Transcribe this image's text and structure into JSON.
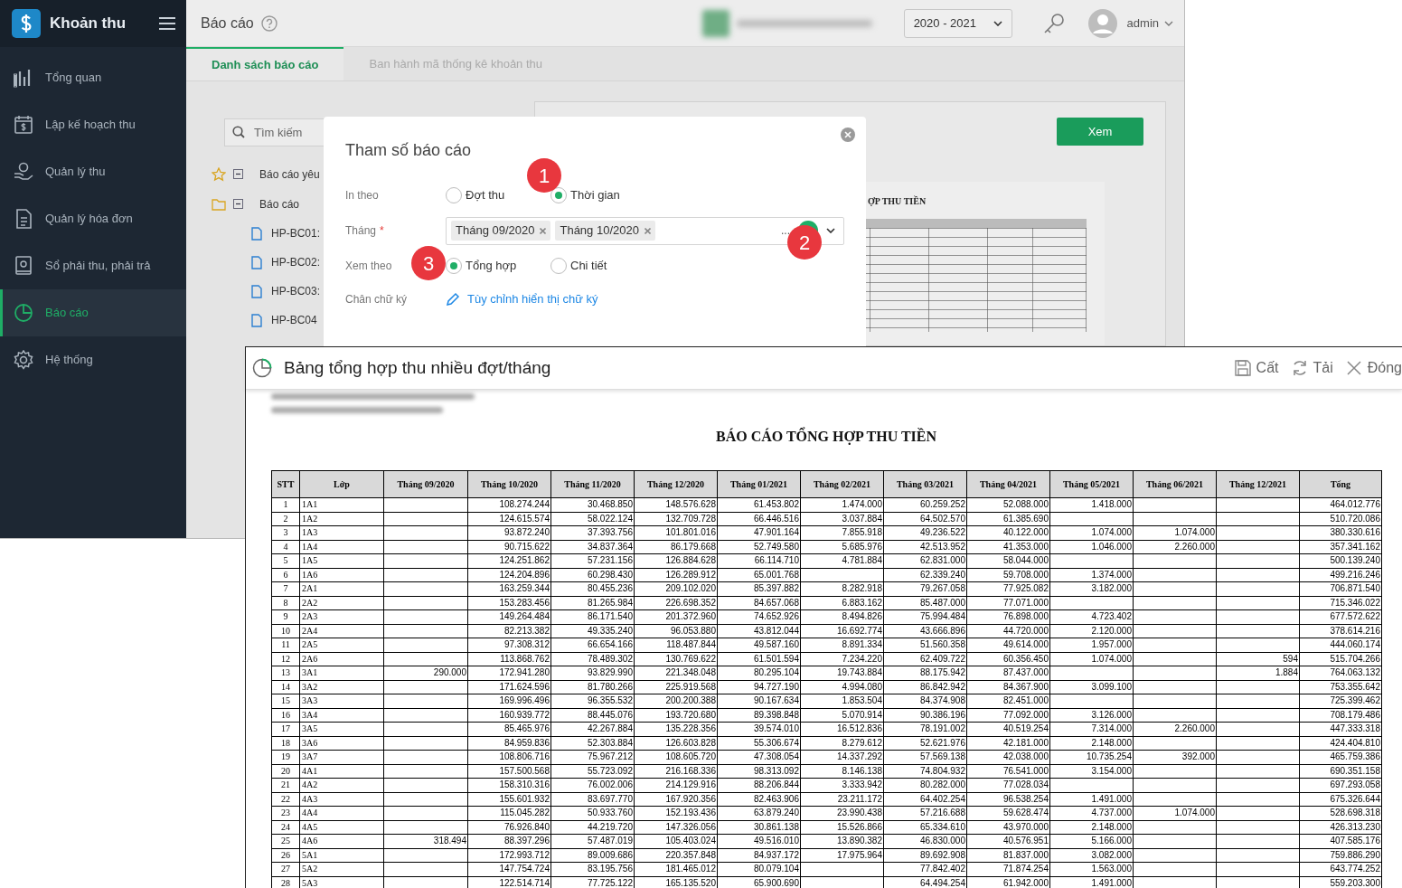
{
  "app": {
    "logo": "Khoản thu",
    "sidebar": [
      {
        "kind": "overview",
        "label": "Tổng quan",
        "selected": false
      },
      {
        "kind": "plan",
        "label": "Lập kế hoạch thu",
        "selected": false
      },
      {
        "kind": "collect",
        "label": "Quản lý thu",
        "selected": false
      },
      {
        "kind": "invoice",
        "label": "Quản lý hóa đơn",
        "selected": false
      },
      {
        "kind": "ledger",
        "label": "Sổ phải thu, phải trả",
        "selected": false
      },
      {
        "kind": "report",
        "label": "Báo cáo",
        "selected": true
      },
      {
        "kind": "settings",
        "label": "Hệ thống",
        "selected": false
      }
    ],
    "header": {
      "title": "Báo cáo",
      "year": "2020 - 2021",
      "user": "admin"
    },
    "tabs": [
      {
        "label": "Danh sách báo cáo",
        "selected": true
      },
      {
        "label": "Ban hành mã thống kê khoản thu",
        "selected": false
      }
    ],
    "search": {
      "placeholder": "Tìm kiếm"
    },
    "tree": [
      {
        "kind": "favorite",
        "label": "Báo cáo yêu",
        "expanded": true
      },
      {
        "kind": "folder",
        "label": "Báo cáo",
        "expanded": true,
        "children": [
          {
            "label": "HP-BC01:"
          },
          {
            "label": "HP-BC02:"
          },
          {
            "label": "HP-BC03:"
          },
          {
            "label": "HP-BC04"
          }
        ]
      }
    ],
    "view_button": "Xem",
    "preview_heading": "ỢP THU TIỀN"
  },
  "dialog": {
    "title": "Tham số báo cáo",
    "fields": [
      {
        "kind": "radio",
        "label": "In theo",
        "options": [
          {
            "label": "Đợt thu",
            "selected": false
          },
          {
            "label": "Thời gian",
            "selected": true
          }
        ]
      },
      {
        "kind": "tags",
        "label": "Tháng",
        "required_mark": "*",
        "tags": [
          "Tháng 09/2020",
          "Tháng 10/2020"
        ],
        "more": "..."
      },
      {
        "kind": "radio",
        "label": "Xem theo",
        "options": [
          {
            "label": "Tổng hợp",
            "selected": true
          },
          {
            "label": "Chi tiết",
            "selected": false
          }
        ]
      },
      {
        "kind": "link",
        "label": "Chân chữ ký",
        "link": "Tùy chỉnh hiển thị chữ ký"
      }
    ]
  },
  "callouts": [
    "1",
    "2",
    "3"
  ],
  "report": {
    "title": "Bảng tổng hợp thu nhiều đợt/tháng",
    "actions": [
      {
        "kind": "save",
        "label": "Cất"
      },
      {
        "kind": "reload",
        "label": "Tải"
      },
      {
        "kind": "close",
        "label": "Đóng"
      }
    ],
    "heading": "BÁO CÁO TỔNG HỢP THU TIỀN",
    "table": {
      "columns": [
        "STT",
        "Lớp",
        "Tháng 09/2020",
        "Tháng 10/2020",
        "Tháng 11/2020",
        "Tháng 12/2020",
        "Tháng 01/2021",
        "Tháng 02/2021",
        "Tháng 03/2021",
        "Tháng 04/2021",
        "Tháng 05/2021",
        "Tháng 06/2021",
        "Tháng 12/2021",
        "Tổng"
      ],
      "rows": [
        [
          "1",
          "1A1",
          null,
          "108.274.244",
          "30.468.850",
          "148.576.628",
          "61.453.802",
          "1.474.000",
          "60.259.252",
          "52.088.000",
          "1.418.000",
          null,
          null,
          "464.012.776"
        ],
        [
          "2",
          "1A2",
          null,
          "124.615.574",
          "58.022.124",
          "132.709.728",
          "66.446.516",
          "3.037.884",
          "64.502.570",
          "61.385.690",
          null,
          null,
          null,
          "510.720.086"
        ],
        [
          "3",
          "1A3",
          null,
          "93.872.240",
          "37.393.756",
          "101.801.016",
          "47.901.164",
          "7.855.918",
          "49.236.522",
          "40.122.000",
          "1.074.000",
          "1.074.000",
          null,
          "380.330.616"
        ],
        [
          "4",
          "1A4",
          null,
          "90.715.622",
          "34.837.364",
          "86.179.668",
          "52.749.580",
          "5.685.976",
          "42.513.952",
          "41.353.000",
          "1.046.000",
          "2.260.000",
          null,
          "357.341.162"
        ],
        [
          "5",
          "1A5",
          null,
          "124.251.862",
          "57.231.156",
          "126.884.628",
          "66.114.710",
          "4.781.884",
          "62.831.000",
          "58.044.000",
          null,
          null,
          null,
          "500.139.240"
        ],
        [
          "6",
          "1A6",
          null,
          "124.204.896",
          "60.298.430",
          "126.289.912",
          "65.001.768",
          null,
          "62.339.240",
          "59.708.000",
          "1.374.000",
          null,
          null,
          "499.216.246"
        ],
        [
          "7",
          "2A1",
          null,
          "163.259.344",
          "80.455.236",
          "209.102.020",
          "85.397.882",
          "8.282.918",
          "79.267.058",
          "77.925.082",
          "3.182.000",
          null,
          null,
          "706.871.540"
        ],
        [
          "8",
          "2A2",
          null,
          "153.283.456",
          "81.265.984",
          "226.698.352",
          "84.657.068",
          "6.883.162",
          "85.487.000",
          "77.071.000",
          null,
          null,
          null,
          "715.346.022"
        ],
        [
          "9",
          "2A3",
          null,
          "149.264.484",
          "86.171.540",
          "201.372.960",
          "74.652.926",
          "8.494.826",
          "75.994.484",
          "76.898.000",
          "4.723.402",
          null,
          null,
          "677.572.622"
        ],
        [
          "10",
          "2A4",
          null,
          "82.213.382",
          "49.335.240",
          "96.053.880",
          "43.812.044",
          "16.692.774",
          "43.666.896",
          "44.720.000",
          "2.120.000",
          null,
          null,
          "378.614.216"
        ],
        [
          "11",
          "2A5",
          null,
          "97.308.312",
          "66.654.166",
          "118.487.844",
          "49.587.160",
          "8.891.334",
          "51.560.358",
          "49.614.000",
          "1.957.000",
          null,
          null,
          "444.060.174"
        ],
        [
          "12",
          "2A6",
          null,
          "113.868.762",
          "78.489.302",
          "130.769.622",
          "61.501.594",
          "7.234.220",
          "62.409.722",
          "60.356.450",
          "1.074.000",
          null,
          "594",
          "515.704.266"
        ],
        [
          "13",
          "3A1",
          "290.000",
          "172.941.280",
          "93.829.990",
          "221.348.048",
          "80.295.104",
          "19.743.884",
          "88.175.942",
          "87.437.000",
          null,
          null,
          "1.884",
          "764.063.132"
        ],
        [
          "14",
          "3A2",
          null,
          "171.624.596",
          "81.780.266",
          "225.919.568",
          "94.727.190",
          "4.994.080",
          "86.842.942",
          "84.367.900",
          "3.099.100",
          null,
          null,
          "753.355.642"
        ],
        [
          "15",
          "3A3",
          null,
          "169.996.496",
          "96.355.532",
          "200.200.388",
          "90.167.634",
          "1.853.504",
          "84.374.908",
          "82.451.000",
          null,
          null,
          null,
          "725.399.462"
        ],
        [
          "16",
          "3A4",
          null,
          "160.939.772",
          "88.445.076",
          "193.720.680",
          "89.398.848",
          "5.070.914",
          "90.386.196",
          "77.092.000",
          "3.126.000",
          null,
          null,
          "708.179.486"
        ],
        [
          "17",
          "3A5",
          null,
          "85.465.976",
          "42.267.884",
          "135.228.356",
          "39.574.010",
          "16.512.836",
          "78.191.002",
          "40.519.254",
          "7.314.000",
          "2.260.000",
          null,
          "447.333.318"
        ],
        [
          "18",
          "3A6",
          null,
          "84.959.836",
          "52.303.884",
          "126.603.828",
          "55.306.674",
          "8.279.612",
          "52.621.976",
          "42.181.000",
          "2.148.000",
          null,
          null,
          "424.404.810"
        ],
        [
          "19",
          "3A7",
          null,
          "108.806.716",
          "75.967.212",
          "108.605.720",
          "47.308.054",
          "14.337.292",
          "57.569.138",
          "42.038.000",
          "10.735.254",
          "392.000",
          null,
          "465.759.386"
        ],
        [
          "20",
          "4A1",
          null,
          "157.500.568",
          "55.723.092",
          "216.168.336",
          "98.313.092",
          "8.146.138",
          "74.804.932",
          "76.541.000",
          "3.154.000",
          null,
          null,
          "690.351.158"
        ],
        [
          "21",
          "4A2",
          null,
          "158.310.316",
          "76.002.006",
          "214.129.916",
          "88.206.844",
          "3.333.942",
          "80.282.000",
          "77.028.034",
          null,
          null,
          null,
          "697.293.058"
        ],
        [
          "22",
          "4A3",
          null,
          "155.601.932",
          "83.697.770",
          "167.920.356",
          "82.463.906",
          "23.211.172",
          "64.402.254",
          "96.538.254",
          "1.491.000",
          null,
          null,
          "675.326.644"
        ],
        [
          "23",
          "4A4",
          null,
          "115.045.282",
          "50.933.760",
          "152.193.436",
          "63.879.240",
          "23.990.438",
          "57.216.688",
          "59.628.474",
          "4.737.000",
          "1.074.000",
          null,
          "528.698.318"
        ],
        [
          "24",
          "4A5",
          null,
          "76.926.840",
          "44.219.720",
          "147.326.056",
          "30.861.138",
          "15.526.866",
          "65.334.610",
          "43.970.000",
          "2.148.000",
          null,
          null,
          "426.313.230"
        ],
        [
          "25",
          "4A6",
          "318.494",
          "88.397.296",
          "57.487.019",
          "105.403.024",
          "49.516.010",
          "13.890.382",
          "46.830.000",
          "40.576.951",
          "5.166.000",
          null,
          null,
          "407.585.176"
        ],
        [
          "26",
          "5A1",
          null,
          "172.993.712",
          "89.009.686",
          "220.357.848",
          "84.937.172",
          "17.975.964",
          "89.692.908",
          "81.837.000",
          "3.082.000",
          null,
          null,
          "759.886.290"
        ],
        [
          "27",
          "5A2",
          null,
          "147.754.724",
          "83.195.756",
          "181.465.012",
          "80.079.104",
          null,
          "77.842.402",
          "71.874.254",
          "1.563.000",
          null,
          null,
          "643.774.252"
        ],
        [
          "28",
          "5A3",
          null,
          "122.514.714",
          "77.725.122",
          "165.135.520",
          "65.900.690",
          null,
          "64.494.254",
          "61.942.000",
          "1.491.000",
          null,
          null,
          "559.203.300"
        ]
      ]
    }
  }
}
